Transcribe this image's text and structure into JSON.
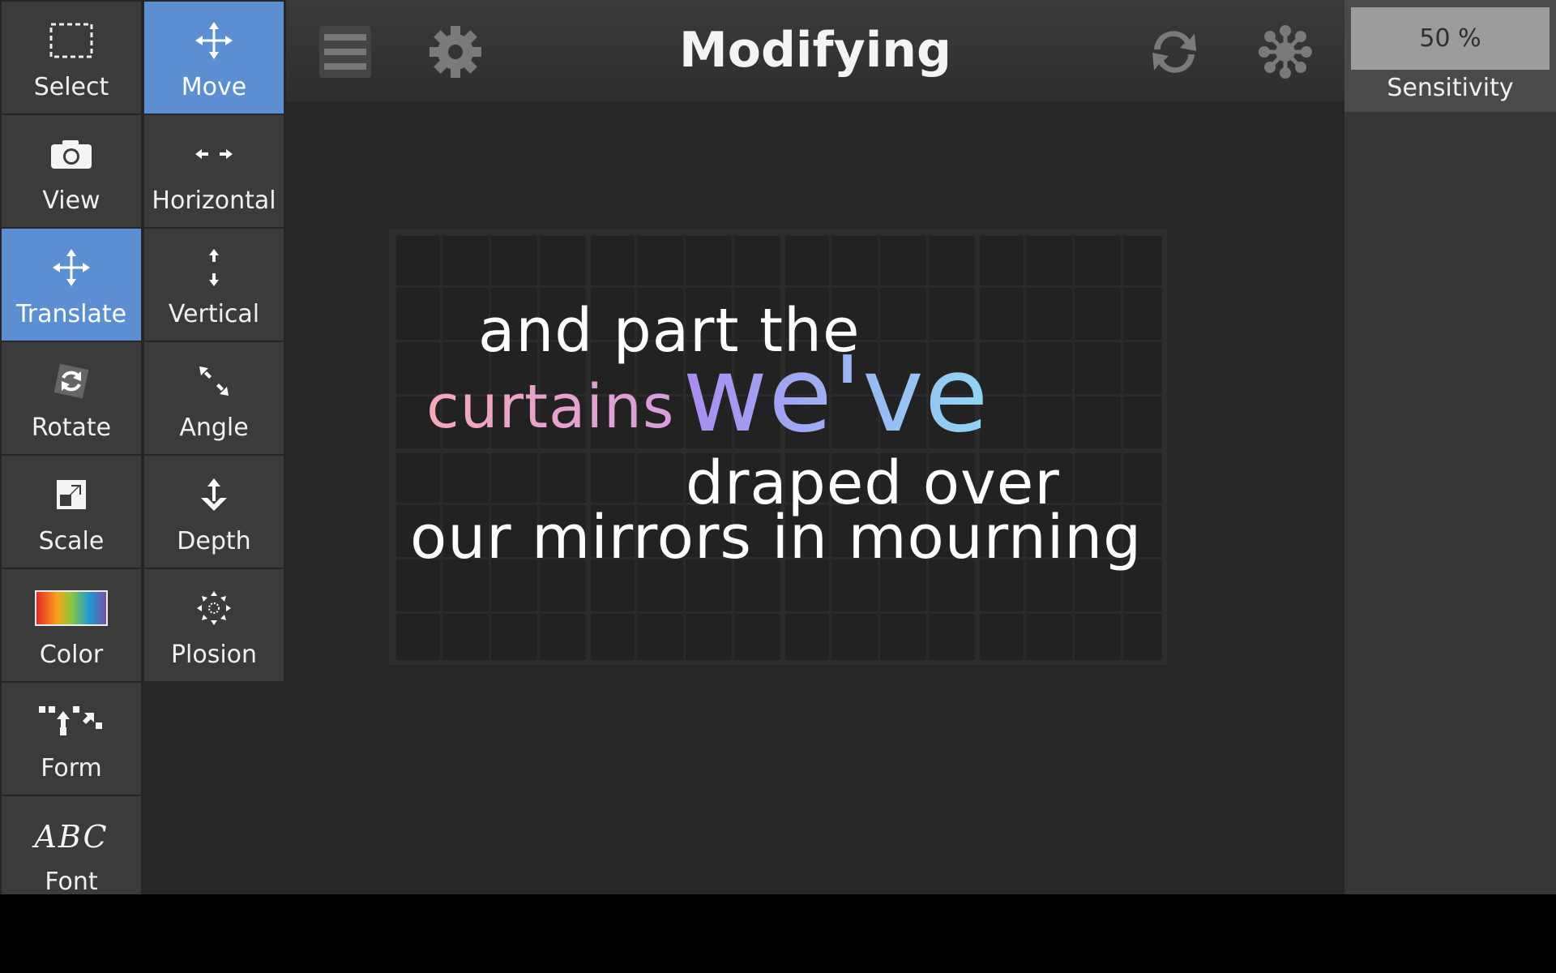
{
  "header": {
    "title": "Modifying"
  },
  "tools": {
    "select": "Select",
    "move": "Move",
    "view": "View",
    "horizontal": "Horizontal",
    "translate": "Translate",
    "vertical": "Vertical",
    "rotate": "Rotate",
    "angle": "Angle",
    "scale": "Scale",
    "depth": "Depth",
    "color": "Color",
    "plosion": "Plosion",
    "form": "Form",
    "font": "Font",
    "font_icon_text": "ABC",
    "active": [
      "Move",
      "Translate"
    ]
  },
  "sensitivity": {
    "value": "50 %",
    "label": "Sensitivity"
  },
  "lyrics": {
    "line1": "and part the",
    "line2_a": "curtains",
    "line2_b": "we've",
    "line3": "draped over",
    "line4": "our mirrors in mourning"
  },
  "colors": {
    "accent": "#5b8fd1",
    "gradient_start": "#f7a8b8",
    "gradient_mid": "#a98cf0",
    "gradient_end": "#8fd6f5"
  },
  "icons": {
    "header_left": [
      "menu-icon",
      "gear-icon"
    ],
    "header_right": [
      "sync-icon",
      "network-icon"
    ]
  }
}
